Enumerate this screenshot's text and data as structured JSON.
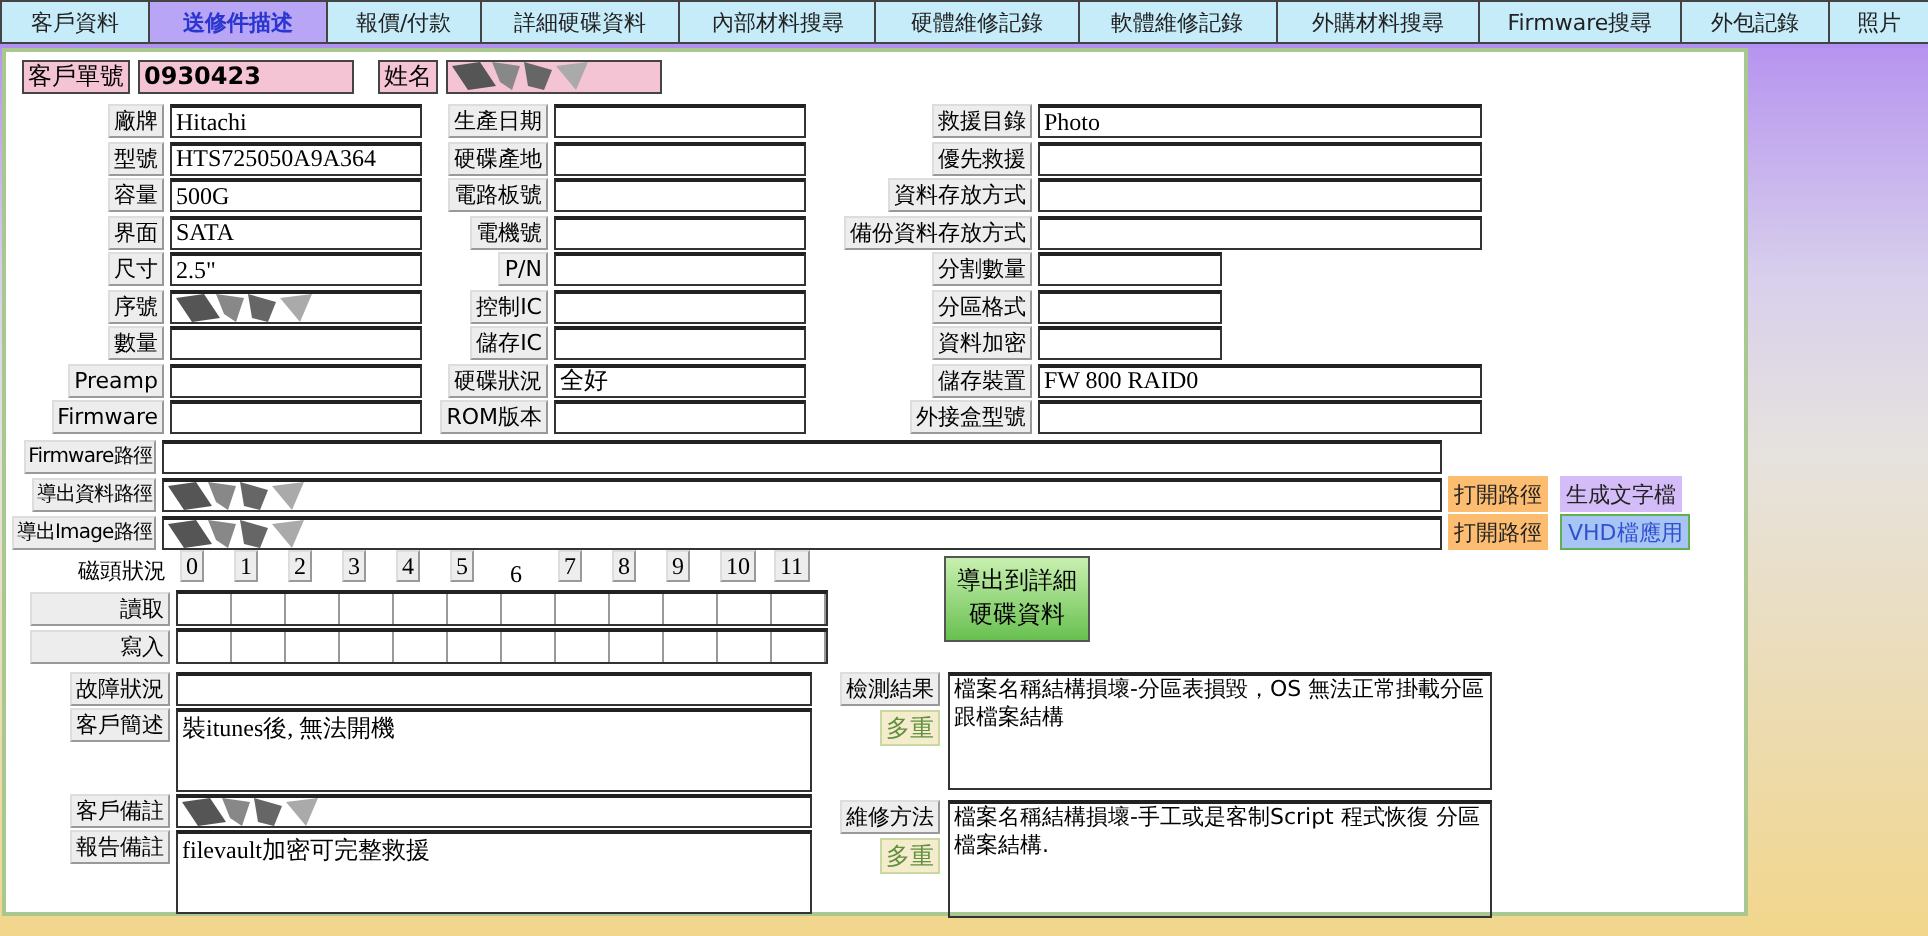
{
  "tabs": [
    {
      "label": "客戶資料",
      "selected": false
    },
    {
      "label": "送修件描述",
      "selected": true
    },
    {
      "label": "報價/付款",
      "selected": false
    },
    {
      "label": "詳細硬碟資料",
      "selected": false
    },
    {
      "label": "內部材料搜尋",
      "selected": false
    },
    {
      "label": "硬體維修記錄",
      "selected": false
    },
    {
      "label": "軟體維修記錄",
      "selected": false
    },
    {
      "label": "外購材料搜尋",
      "selected": false
    },
    {
      "label": "Firmware搜尋",
      "selected": false
    },
    {
      "label": "外包記錄",
      "selected": false
    },
    {
      "label": "照片",
      "selected": false
    }
  ],
  "header": {
    "order_label": "客戶單號",
    "order_number": "0930423",
    "name_label": "姓名",
    "name_redacted": true
  },
  "left_fields": [
    {
      "label": "廠牌",
      "value": "Hitachi",
      "redacted": false
    },
    {
      "label": "型號",
      "value": "HTS725050A9A364",
      "redacted": false
    },
    {
      "label": "容量",
      "value": "500G",
      "redacted": false
    },
    {
      "label": "界面",
      "value": "SATA",
      "redacted": false
    },
    {
      "label": "尺寸",
      "value": "2.5\"",
      "redacted": false
    },
    {
      "label": "序號",
      "redacted": true
    },
    {
      "label": "數量",
      "redacted": false
    },
    {
      "label": "Preamp",
      "redacted": false
    },
    {
      "label": "Firmware",
      "redacted": false
    }
  ],
  "middle_fields": [
    {
      "label": "生產日期"
    },
    {
      "label": "硬碟產地"
    },
    {
      "label": "電路板號"
    },
    {
      "label": "電機號"
    },
    {
      "label": "P/N"
    },
    {
      "label": "控制IC"
    },
    {
      "label": "儲存IC"
    },
    {
      "label": "硬碟狀況",
      "value": "全好"
    },
    {
      "label": "ROM版本"
    }
  ],
  "right_fields": [
    {
      "label": "救援目錄",
      "value": "Photo",
      "kind": "wide"
    },
    {
      "label": "優先救援",
      "kind": "wide"
    },
    {
      "label": "資料存放方式",
      "kind": "wide"
    },
    {
      "label": "備份資料存放方式",
      "kind": "wide"
    },
    {
      "label": "分割數量",
      "kind": "short"
    },
    {
      "label": "分區格式",
      "kind": "short"
    },
    {
      "label": "資料加密",
      "kind": "short"
    },
    {
      "label": "儲存裝置",
      "value": "FW 800 RAID0",
      "kind": "wide"
    },
    {
      "label": "外接盒型號",
      "kind": "wide"
    }
  ],
  "paths": [
    {
      "label": "Firmware路徑",
      "redacted": false
    },
    {
      "label": "導出資料路徑",
      "redacted": true,
      "actions": [
        {
          "label": "打開路徑",
          "kind": "open"
        },
        {
          "label": "生成文字檔",
          "kind": "text"
        }
      ]
    },
    {
      "label": "導出Image路徑",
      "redacted": true,
      "actions": [
        {
          "label": "打開路徑",
          "kind": "open"
        },
        {
          "label": "VHD檔應用",
          "kind": "vhd"
        }
      ]
    }
  ],
  "heads": {
    "label": "磁頭狀況",
    "numbers": [
      {
        "label": "0",
        "selected": false
      },
      {
        "label": "1",
        "selected": false
      },
      {
        "label": "2",
        "selected": false
      },
      {
        "label": "3",
        "selected": false
      },
      {
        "label": "4",
        "selected": false
      },
      {
        "label": "5",
        "selected": false
      },
      {
        "label": "6",
        "selected": true
      },
      {
        "label": "7",
        "selected": false
      },
      {
        "label": "8",
        "selected": false
      },
      {
        "label": "9",
        "selected": false
      },
      {
        "label": "10",
        "selected": false
      },
      {
        "label": "11",
        "selected": false
      }
    ]
  },
  "head_rows": [
    {
      "label": "讀取"
    },
    {
      "label": "寫入"
    }
  ],
  "export_button": "導出到詳細硬碟資料",
  "notes": [
    {
      "label": "故障狀況",
      "kind": "line",
      "redacted": false
    },
    {
      "label": "客戶簡述",
      "value": "裝itunes後, 無法開機",
      "kind": "box",
      "redacted": false
    },
    {
      "label": "客戶備註",
      "kind": "line",
      "redacted": true
    },
    {
      "label": "報告備註",
      "value": "filevault加密可完整救援",
      "kind": "box",
      "redacted": false
    }
  ],
  "results": [
    {
      "label": "檢測結果",
      "button": "多重",
      "value": "檔案名稱結構損壞-分區表損毀，OS 無法正常掛載分區跟檔案結構"
    },
    {
      "label": "維修方法",
      "button": "多重",
      "value": "檔案名稱結構損壞-手工或是客制Script 程式恢復 分區檔案結構."
    }
  ]
}
